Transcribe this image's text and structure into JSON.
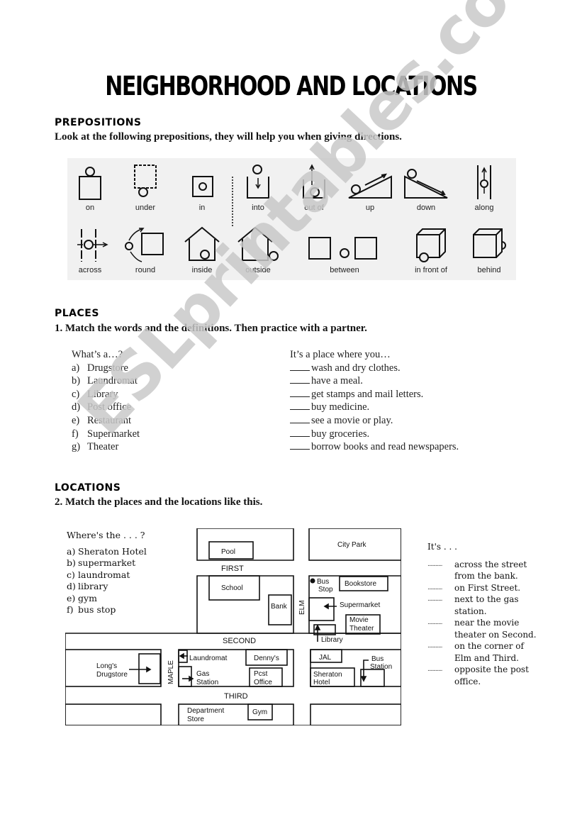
{
  "title": "NEIGHBORHOOD AND LOCATIONS",
  "watermark": "ESLprintables.com",
  "prepositions": {
    "heading": "PREPOSITIONS",
    "instruction": "Look at the following prepositions, they will help you when giving directions.",
    "row1": [
      {
        "label": "on",
        "icon": "ball-on-box-icon"
      },
      {
        "label": "under",
        "icon": "ball-under-box-icon"
      },
      {
        "label": "in",
        "icon": "ball-in-box-icon"
      },
      {
        "label": "into",
        "icon": "ball-into-box-icon"
      },
      {
        "label": "out of",
        "icon": "ball-out-of-box-icon"
      },
      {
        "label": "up",
        "icon": "ball-up-slope-icon"
      },
      {
        "label": "down",
        "icon": "ball-down-slope-icon"
      },
      {
        "label": "along",
        "icon": "ball-along-lines-icon"
      }
    ],
    "row2": [
      {
        "label": "across",
        "icon": "ball-across-lines-icon"
      },
      {
        "label": "round",
        "icon": "ball-round-box-icon"
      },
      {
        "label": "inside",
        "icon": "ball-inside-house-icon"
      },
      {
        "label": "outside",
        "icon": "ball-outside-house-icon"
      },
      {
        "label": "between",
        "icon": "ball-between-boxes-icon"
      },
      {
        "label": "in front of",
        "icon": "ball-in-front-of-cube-icon"
      },
      {
        "label": "behind",
        "icon": "ball-behind-cube-icon"
      }
    ]
  },
  "places": {
    "heading": "PLACES",
    "instruction": "1. Match the words and the definitions. Then practice with a partner.",
    "left_header": "What’s a…?",
    "words": [
      {
        "letter": "a)",
        "text": "Drugstore"
      },
      {
        "letter": "b)",
        "text": "Laundromat"
      },
      {
        "letter": "c)",
        "text": "Library"
      },
      {
        "letter": "d)",
        "text": "Post office"
      },
      {
        "letter": "e)",
        "text": "Restaurant"
      },
      {
        "letter": "f)",
        "text": "Supermarket"
      },
      {
        "letter": "g)",
        "text": "Theater"
      }
    ],
    "right_header": "It’s a place where you…",
    "definitions": [
      "wash and dry clothes.",
      "have a meal.",
      "get stamps and mail letters.",
      "buy medicine.",
      "see a movie or play.",
      "buy groceries.",
      "borrow books and read newspapers."
    ]
  },
  "locations": {
    "heading": "LOCATIONS",
    "instruction": "2. Match the places and the locations like this.",
    "left_header": "Where's the . . . ?",
    "places": [
      {
        "letter": "a)",
        "text": "Sheraton Hotel"
      },
      {
        "letter": "b)",
        "text": "supermarket"
      },
      {
        "letter": "c)",
        "text": "laundromat"
      },
      {
        "letter": "d)",
        "text": "library"
      },
      {
        "letter": "e)",
        "text": "gym"
      },
      {
        "letter": "f)",
        "text": "bus stop"
      }
    ],
    "right_header": "It's . . .",
    "answer_dots": "...........",
    "answers": [
      [
        "across the street",
        "from the bank."
      ],
      [
        "on First Street."
      ],
      [
        "next to the gas",
        "station."
      ],
      [
        "near the movie",
        "theater on Second."
      ],
      [
        "on the corner of",
        "Elm and Third."
      ],
      [
        "opposite the post",
        "office."
      ]
    ],
    "map": {
      "streets": {
        "first": "FIRST",
        "second": "SECOND",
        "third": "THIRD",
        "elm": "ELM",
        "maple": "MAPLE"
      },
      "buildings": {
        "pool": "Pool",
        "city_park": "City Park",
        "school": "School",
        "bank": "Bank",
        "bus_stop_1": "Bus",
        "bus_stop_2": "Stop",
        "bookstore": "Bookstore",
        "supermarket": "Supermarket",
        "movie_theater_1": "Movie",
        "movie_theater_2": "Theater",
        "library": "Library",
        "longs_1": "Long's",
        "longs_2": "Drugstore",
        "laundromat": "Laundromat",
        "dennys": "Denny's",
        "gas_1": "Gas",
        "gas_2": "Station",
        "post_1": "Pcst",
        "post_2": "Office",
        "jal": "JAL",
        "bus_station_1": "Bus",
        "bus_station_2": "Station",
        "sheraton_1": "Sheraton",
        "sheraton_2": "Hotel",
        "dept_1": "Department",
        "dept_2": "Store",
        "gym": "Gym"
      }
    }
  }
}
